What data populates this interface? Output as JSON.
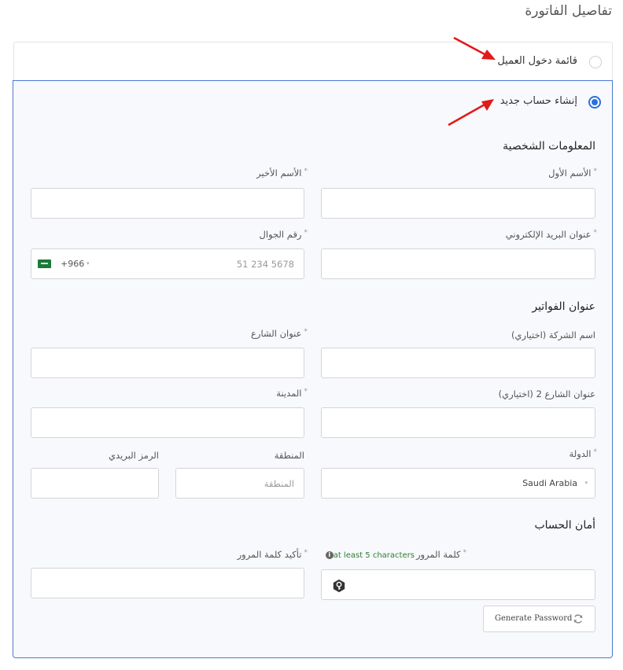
{
  "page_title": "تفاصيل الفاتورة",
  "options": {
    "login": "قائمة دخول العميل",
    "create_account": "إنشاء حساب جديد"
  },
  "sections": {
    "personal": "المعلومات الشخصية",
    "billing": "عنوان الفواتير",
    "security": "أمان الحساب"
  },
  "required_mark": "*",
  "fields": {
    "first_name": {
      "label": "الأسم الأول",
      "value": ""
    },
    "last_name": {
      "label": "الأسم الأخير",
      "value": ""
    },
    "email": {
      "label": "عنوان البريد الإلكتروني",
      "value": ""
    },
    "phone": {
      "label": "رقم الجوال",
      "placeholder": "5678 234 51",
      "dial_code": "+966",
      "caret": "▾"
    },
    "company": {
      "label": "اسم الشركة (اختياري)",
      "value": ""
    },
    "street": {
      "label": "عنوان الشارع",
      "value": ""
    },
    "street2": {
      "label": "عنوان الشارع 2 (اختياري)",
      "value": ""
    },
    "city": {
      "label": "المدينة",
      "value": ""
    },
    "country": {
      "label": "الدولة",
      "value": "Saudi Arabia",
      "caret": "▾"
    },
    "region": {
      "label": "المنطقة",
      "placeholder": "المنطقة"
    },
    "postcode": {
      "label": "الرمز البريدي",
      "value": ""
    },
    "password": {
      "label": "كلمة المرور",
      "hint": "at least 5 characters",
      "info": "i"
    },
    "confirm_password": {
      "label": "تأكيد كلمة المرور",
      "value": ""
    }
  },
  "generate_password": "Generate Password",
  "icons": {
    "info": "info-icon",
    "key": "key-icon",
    "refresh": "refresh-icon",
    "flag": "saudi-flag-icon"
  },
  "colors": {
    "accent": "#2a6fdb",
    "panel_border": "#4a7ad0",
    "annotation_arrow": "#e01b1b",
    "hint_green": "#2e7d32"
  }
}
